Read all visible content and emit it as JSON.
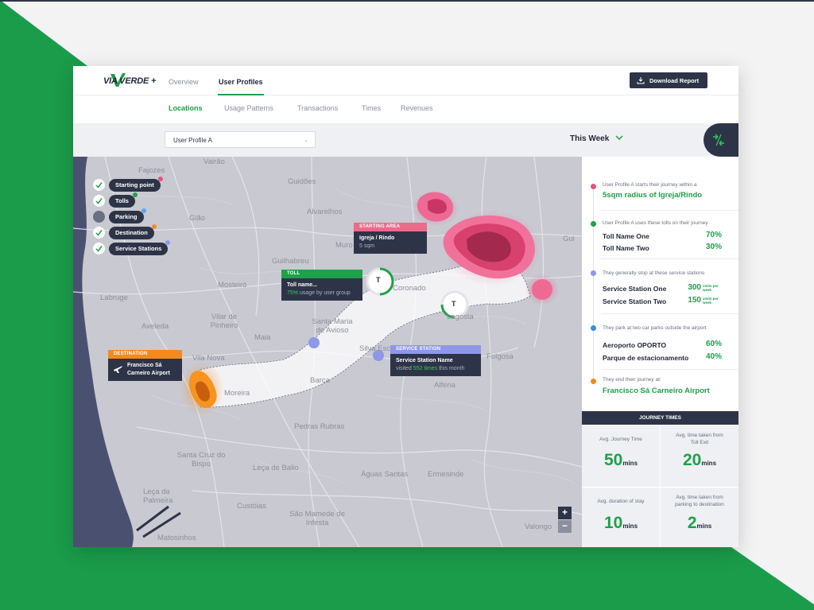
{
  "colors": {
    "brand_green": "#1fa04a",
    "navy": "#2e3448",
    "starting": "#e8547a",
    "destination": "#f48a1e",
    "service": "#8e97e8",
    "toll": "#1fa04a"
  },
  "app": {
    "brand": "VIA VERDE +"
  },
  "nav": {
    "tabs": [
      {
        "label": "Overview"
      },
      {
        "label": "User Profiles"
      }
    ],
    "download_label": "Download Report"
  },
  "subnav": {
    "tabs": [
      {
        "label": "Locations"
      },
      {
        "label": "Usage Patterns"
      },
      {
        "label": "Transactions"
      },
      {
        "label": "Times"
      },
      {
        "label": "Revenues"
      }
    ]
  },
  "filters": {
    "profile": "User Profile A",
    "period": "This Week"
  },
  "legend": [
    {
      "label": "Starting point",
      "checked": true
    },
    {
      "label": "Tolls",
      "checked": true
    },
    {
      "label": "Parking",
      "checked": false
    },
    {
      "label": "Destination",
      "checked": true
    },
    {
      "label": "Service Stations",
      "checked": true
    }
  ],
  "map": {
    "places": [
      "Fajozes",
      "Vairão",
      "Guidões",
      "Gião",
      "Alvarelhos",
      "Mosteiró",
      "Guilhabreu",
      "Muro",
      "Gui",
      "Labruge",
      "Vilar de Pinheiro",
      "Aveleda",
      "Vila Nova",
      "Maia",
      "Santa Maria de Avioso",
      "Silva Esc",
      "Lagosta",
      "Moreira",
      "Barca",
      "Leça de Balio",
      "Santa Cruz do Bispo",
      "Leça da Palmeira",
      "São Mamede de Infesta",
      "Custóias",
      "Águas Santas",
      "Ermesinde",
      "Matosinhos",
      "Valongo",
      "Pedras Rubras",
      "Alfena",
      "Folgosa",
      "Coronado"
    ],
    "starting": {
      "head": "STARTING AREA",
      "title": "Igreja / Rindo",
      "sub": "5 sqm"
    },
    "toll": {
      "head": "TOLL",
      "title": "Toll name...",
      "sub_pct": "75%",
      "sub_text": "usage by user group",
      "marker": "T"
    },
    "service": {
      "head": "SERVICE STATION",
      "title": "Service Station Name",
      "sub_pre": "visited",
      "sub_times": "552 times",
      "sub_post": "this month"
    },
    "destination": {
      "head": "DESTINATION",
      "title": "Francisco Sá Carneiro Airport"
    },
    "zoom_in": "+",
    "zoom_out": "−"
  },
  "journey": {
    "start_text": "User Profile A starts their journey within a",
    "start_big": "5sqm radius of Igreja/Rindo",
    "tolls_text": "User Profile A uses these tolls on their journey",
    "tolls": [
      {
        "name": "Toll Name One",
        "value": "70%"
      },
      {
        "name": "Toll Name Two",
        "value": "30%"
      }
    ],
    "stations_text": "They generally stop at these service stations",
    "stations": [
      {
        "name": "Service Station One",
        "value": "300",
        "unit": "visits per week"
      },
      {
        "name": "Service Station Two",
        "value": "150",
        "unit": "visits per week"
      }
    ],
    "parks_text": "They park at two car parks outside the airport",
    "parks": [
      {
        "name": "Aeroporto OPORTO",
        "value": "60%"
      },
      {
        "name": "Parque de estacionamento",
        "value": "40%"
      }
    ],
    "end_text": "They end their journey at:",
    "end_big": "Francisco Sá Carneiro Airport"
  },
  "journey_times": {
    "title": "JOURNEY TIMES",
    "cells": [
      {
        "label": "Avg. Journey Time",
        "value": "50",
        "unit": "mins"
      },
      {
        "label": "Avg. time taken from Toll Exit",
        "value": "20",
        "unit": "mins"
      },
      {
        "label": "Avg. duration of stay",
        "value": "10",
        "unit": "mins"
      },
      {
        "label": "Avg. time taken from parking to destination",
        "value": "2",
        "unit": "mins"
      }
    ]
  }
}
